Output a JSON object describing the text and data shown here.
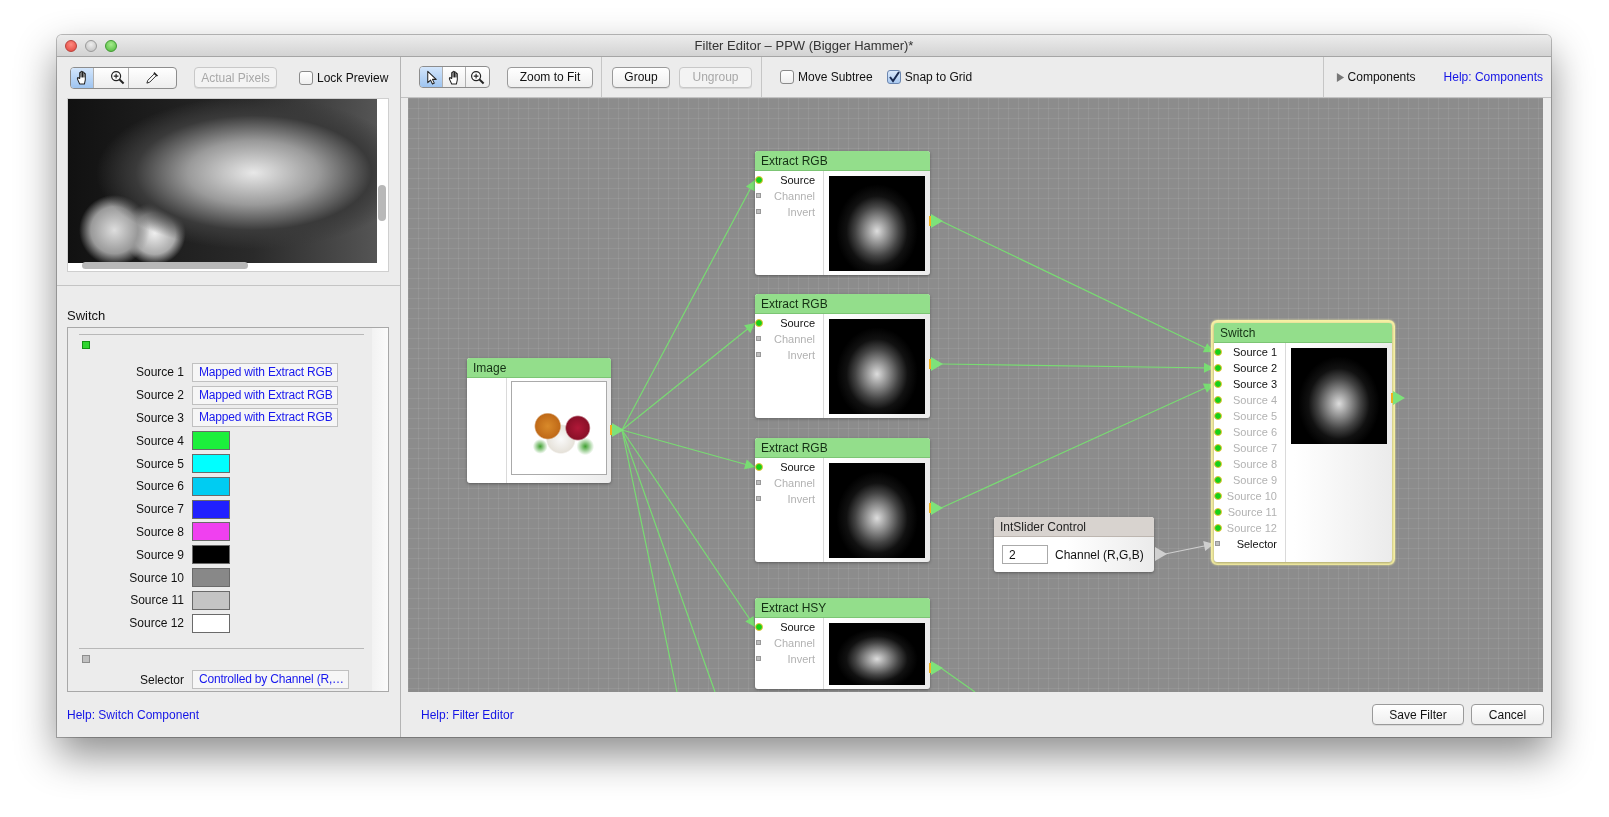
{
  "window": {
    "title": "Filter Editor – PPW (Bigger Hammer)*"
  },
  "preview_toolbar": {
    "tools": [
      {
        "kind": "hand",
        "selected": true
      },
      {
        "kind": "zoom",
        "selected": false
      },
      {
        "kind": "eyedropper",
        "selected": false
      }
    ],
    "buttons": [
      {
        "label": "Actual Pixels",
        "disabled": true
      }
    ],
    "lock_preview": {
      "label": "Lock Preview",
      "checked": false
    }
  },
  "inspector": {
    "title": "Switch",
    "sections": [
      {
        "kind": "image",
        "rows": [
          {
            "label": "Source 1",
            "kind": "mapping",
            "value": "Mapped with Extract RGB"
          },
          {
            "label": "Source 2",
            "kind": "mapping",
            "value": "Mapped with Extract RGB"
          },
          {
            "label": "Source 3",
            "kind": "mapping",
            "value": "Mapped with Extract RGB"
          },
          {
            "label": "Source 4",
            "kind": "color",
            "color": "#1cf03c"
          },
          {
            "label": "Source 5",
            "kind": "color",
            "color": "#00ffff"
          },
          {
            "label": "Source 6",
            "kind": "color",
            "color": "#00ccf2"
          },
          {
            "label": "Source 7",
            "kind": "color",
            "color": "#2020ff"
          },
          {
            "label": "Source 8",
            "kind": "color",
            "color": "#f040f0"
          },
          {
            "label": "Source 9",
            "kind": "color",
            "color": "#000000"
          },
          {
            "label": "Source 10",
            "kind": "color",
            "color": "#888888"
          },
          {
            "label": "Source 11",
            "kind": "color",
            "color": "#c4c4c4"
          },
          {
            "label": "Source 12",
            "kind": "color",
            "color": "#ffffff"
          }
        ]
      },
      {
        "kind": "value",
        "rows": [
          {
            "label": "Selector",
            "kind": "mapping",
            "value": "Controlled by Channel (R,…"
          }
        ]
      }
    ],
    "help_link": "Help: Switch Component"
  },
  "toolbar": {
    "tools": [
      {
        "kind": "pointer",
        "selected": true
      },
      {
        "kind": "hand",
        "selected": false
      },
      {
        "kind": "zoom",
        "selected": false
      }
    ],
    "buttons": [
      {
        "label": "Zoom to Fit",
        "disabled": false
      },
      {
        "label": "Group",
        "disabled": false
      },
      {
        "label": "Ungroup",
        "disabled": true
      }
    ],
    "checkboxes": [
      {
        "label": "Move Subtree",
        "checked": false
      },
      {
        "label": "Snap to Grid",
        "checked": true
      }
    ],
    "components": {
      "label": "Components",
      "expanded": false
    },
    "help_link": "Help: Components"
  },
  "nodes": [
    {
      "kind": "image",
      "title": "Image",
      "selected": false
    },
    {
      "kind": "filter",
      "title": "Extract RGB",
      "selected": false,
      "ports": [
        {
          "label": "Source",
          "kind": "image",
          "connected": true
        },
        {
          "label": "Channel",
          "kind": "value",
          "connected": false
        },
        {
          "label": "Invert",
          "kind": "value",
          "connected": false
        }
      ]
    },
    {
      "kind": "filter",
      "title": "Extract RGB",
      "selected": false,
      "ports": [
        {
          "label": "Source",
          "kind": "image",
          "connected": true
        },
        {
          "label": "Channel",
          "kind": "value",
          "connected": false
        },
        {
          "label": "Invert",
          "kind": "value",
          "connected": false
        }
      ]
    },
    {
      "kind": "filter",
      "title": "Extract RGB",
      "selected": false,
      "ports": [
        {
          "label": "Source",
          "kind": "image",
          "connected": true
        },
        {
          "label": "Channel",
          "kind": "value",
          "connected": false
        },
        {
          "label": "Invert",
          "kind": "value",
          "connected": false
        }
      ]
    },
    {
      "kind": "filter",
      "title": "Extract HSY",
      "selected": false,
      "ports": [
        {
          "label": "Source",
          "kind": "image",
          "connected": true
        },
        {
          "label": "Channel",
          "kind": "value",
          "connected": false
        },
        {
          "label": "Invert",
          "kind": "value",
          "connected": false
        }
      ]
    },
    {
      "kind": "control",
      "title": "IntSlider Control",
      "selected": false,
      "value": "2",
      "label": "Channel (R,G,B)"
    },
    {
      "kind": "filter",
      "title": "Switch",
      "selected": true,
      "ports": [
        {
          "label": "Source 1",
          "kind": "image",
          "connected": true
        },
        {
          "label": "Source 2",
          "kind": "image",
          "connected": true
        },
        {
          "label": "Source 3",
          "kind": "image",
          "connected": true
        },
        {
          "label": "Source 4",
          "kind": "image",
          "connected": false
        },
        {
          "label": "Source 5",
          "kind": "image",
          "connected": false
        },
        {
          "label": "Source 6",
          "kind": "image",
          "connected": false
        },
        {
          "label": "Source 7",
          "kind": "image",
          "connected": false
        },
        {
          "label": "Source 8",
          "kind": "image",
          "connected": false
        },
        {
          "label": "Source 9",
          "kind": "image",
          "connected": false
        },
        {
          "label": "Source 10",
          "kind": "image",
          "connected": false
        },
        {
          "label": "Source 11",
          "kind": "image",
          "connected": false
        },
        {
          "label": "Source 12",
          "kind": "image",
          "connected": false
        },
        {
          "label": "Selector",
          "kind": "value",
          "connected": true
        }
      ]
    }
  ],
  "bottom_bar": {
    "help_link": "Help: Filter Editor",
    "buttons": [
      "Save Filter",
      "Cancel"
    ]
  }
}
